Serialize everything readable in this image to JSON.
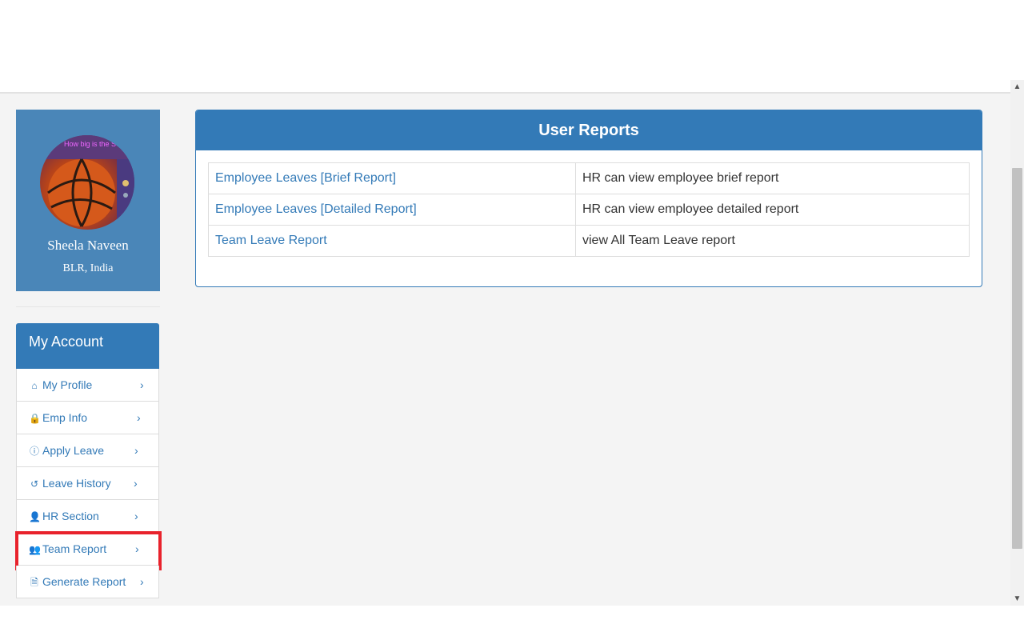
{
  "profile": {
    "name": "Sheela Naveen",
    "location": "BLR, India",
    "avatar_caption": "How big is the SUN?"
  },
  "account": {
    "title": "My Account",
    "items": [
      {
        "label": "My Profile",
        "icon": "home-icon",
        "glyph": "⌂"
      },
      {
        "label": "Emp Info",
        "icon": "lock-icon",
        "glyph": "🔒"
      },
      {
        "label": "Apply Leave",
        "icon": "info-circle-icon",
        "glyph": "ⓘ"
      },
      {
        "label": "Leave History",
        "icon": "history-icon",
        "glyph": "↺"
      },
      {
        "label": "HR Section",
        "icon": "user-icon",
        "glyph": "👤"
      },
      {
        "label": "Team Report",
        "icon": "users-icon",
        "glyph": "👥"
      },
      {
        "label": "Generate Report",
        "icon": "file-excel-icon",
        "glyph": "🗎"
      }
    ],
    "chevron": "›",
    "highlighted_item": "Team Report"
  },
  "reports": {
    "title": "User Reports",
    "rows": [
      {
        "link": "Employee Leaves [Brief Report]",
        "description": "HR can view employee brief report"
      },
      {
        "link": "Employee Leaves [Detailed Report]",
        "description": "HR can view employee detailed report"
      },
      {
        "link": "Team Leave Report",
        "description": "view All Team Leave report"
      }
    ]
  },
  "colors": {
    "primary": "#337ab7",
    "profile_bg": "#4a86b8",
    "highlight": "#e8222c",
    "content_bg": "#f4f4f4"
  }
}
